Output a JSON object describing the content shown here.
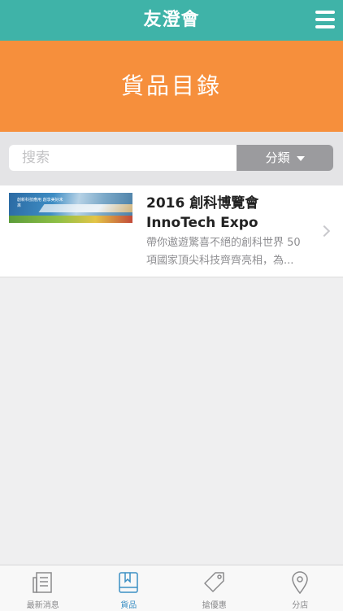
{
  "header": {
    "title": "友澄會",
    "menu_icon": "hamburger-menu-icon"
  },
  "banner": {
    "heading": "貨品目錄"
  },
  "search": {
    "placeholder": "搜索",
    "category_label": "分類",
    "category_icon": "caret-down-icon"
  },
  "products": [
    {
      "title": "2016 創科博覽會 InnoTech Expo",
      "description": "帶你遨遊驚喜不絕的創科世界 50項國家頂尖科技齊齊亮相，為...",
      "thumbnail_text": "創新科技應用 創享美好未來"
    }
  ],
  "tabbar": {
    "tabs": [
      {
        "label": "最新消息",
        "icon": "newspaper-icon",
        "active": false
      },
      {
        "label": "貨品",
        "icon": "book-icon",
        "active": true
      },
      {
        "label": "搶優惠",
        "icon": "tag-icon",
        "active": false
      },
      {
        "label": "分店",
        "icon": "location-pin-icon",
        "active": false
      }
    ]
  },
  "colors": {
    "header": "#3fb3a8",
    "banner": "#f68f3c",
    "active_tab": "#3b8fc4",
    "category_button": "#9b9b9e"
  }
}
